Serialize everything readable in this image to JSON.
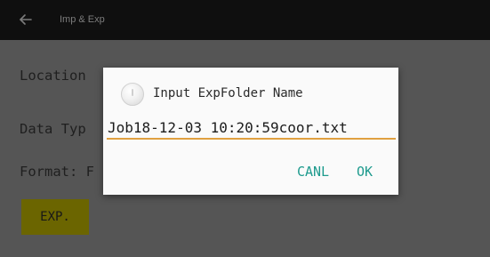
{
  "appbar": {
    "title": "Imp & Exp",
    "back_icon": "arrow-left-icon"
  },
  "form": {
    "location_label": "Location",
    "data_type_label": "Data Typ",
    "format_label": "Format: F"
  },
  "exp_button": {
    "label": "EXP."
  },
  "dialog": {
    "icon": "info-icon",
    "title": "Input ExpFolder Name",
    "input_value": "Job18-12-03 10:20:59coor.txt",
    "cancel_label": "CANL",
    "ok_label": "OK"
  },
  "colors": {
    "appbar_bg": "#0f0f0f",
    "screen_bg": "#555555",
    "dialog_bg": "#fafafa",
    "accent_text": "#1f9b8e",
    "input_underline": "#e0a040",
    "exp_button_bg": "#6b6500"
  }
}
